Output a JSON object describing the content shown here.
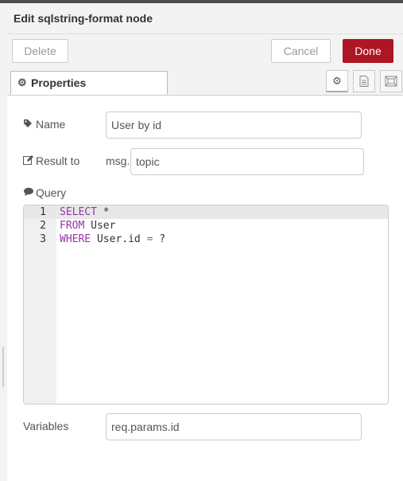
{
  "tray": {
    "title": "Edit sqlstring-format node"
  },
  "toolbar": {
    "delete_label": "Delete",
    "cancel_label": "Cancel",
    "done_label": "Done"
  },
  "tabs": {
    "properties_label": "Properties",
    "icons": [
      "gear-icon",
      "description-icon",
      "appearance-icon"
    ]
  },
  "form": {
    "name": {
      "label": "Name",
      "value": "User by id",
      "icon": "tag-icon"
    },
    "result_to": {
      "label": "Result to",
      "prefix": "msg.",
      "value": "topic",
      "icon": "edit-icon"
    },
    "query": {
      "label": "Query",
      "icon": "comments-icon",
      "lines": [
        {
          "number": "1",
          "keyword": "SELECT",
          "rest": " *",
          "op": "",
          "tail": ""
        },
        {
          "number": "2",
          "keyword": "FROM",
          "rest": " User",
          "op": "",
          "tail": ""
        },
        {
          "number": "3",
          "keyword": "WHERE",
          "rest": " User.id ",
          "op": "=",
          "tail": " ?"
        }
      ]
    },
    "variables": {
      "label": "Variables",
      "value": "req.params.id"
    }
  },
  "colors": {
    "done_button": "#ad1625",
    "keyword": "#9933aa",
    "operator": "#1c8fbf"
  }
}
